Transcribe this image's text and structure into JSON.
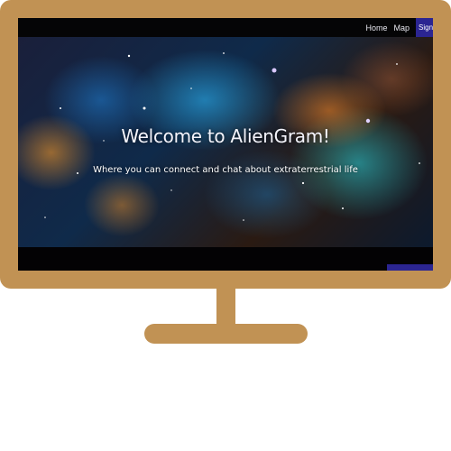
{
  "nav": {
    "links": [
      "Home",
      "Map"
    ],
    "signup_label": "Sign Up"
  },
  "hero": {
    "title": "Welcome to AlienGram!",
    "subtitle": "Where you can connect and chat about extraterrestrial life"
  },
  "colors": {
    "frame": "#c19254",
    "accent": "#2b2592",
    "screen_bg": "#030204"
  }
}
